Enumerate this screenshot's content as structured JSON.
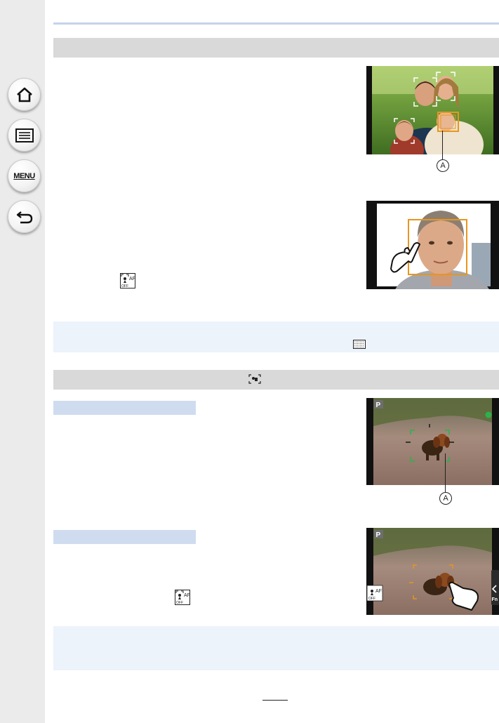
{
  "navigation": {
    "home_icon": "home-icon",
    "toc_icon": "list-icon",
    "menu_label": "MENU",
    "back_icon": "back-arrow-icon"
  },
  "figures": {
    "face_detection": {
      "marker": "A"
    },
    "touch_face": {},
    "animal_detection": {
      "marker": "A",
      "mode_badge": "P"
    },
    "touch_animal": {
      "mode_badge": "P",
      "side_tab_fn": "Fn",
      "af_icon_label": "AF",
      "af_icon_sub": "OFF"
    }
  },
  "inline_icons": {
    "af_off_icon_1": {
      "label": "AF",
      "sub": "OFF"
    },
    "af_off_icon_2": {
      "label": "AF",
      "sub": "OFF"
    }
  },
  "colors": {
    "sidebar": "#ebebeb",
    "section_bar": "#d9d9d9",
    "note_box": "#edf3fb",
    "sub_tab": "#cfdcef",
    "af_frame_orange": "#e8961e",
    "af_frame_green": "#2bb24c"
  }
}
